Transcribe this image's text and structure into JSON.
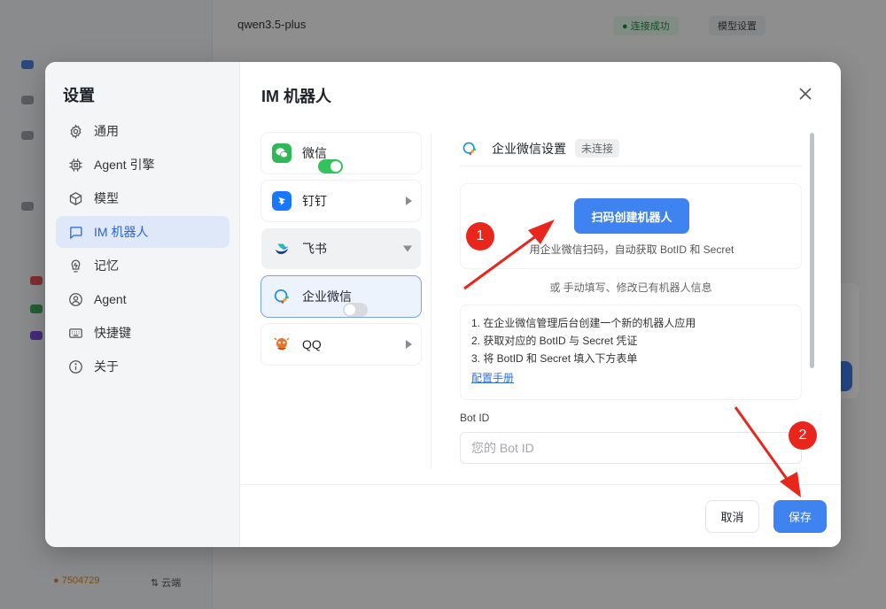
{
  "background": {
    "model_selector": "qwen3.5-plus",
    "status_badge": "● 连接成功",
    "pill": "模型设置",
    "bottom_left": "● 7504729",
    "bottom_right": "⇅ 云端"
  },
  "dialog": {
    "title": "设置",
    "main_title": "IM 机器人",
    "close_icon": "close-icon"
  },
  "nav": [
    {
      "label": "通用",
      "icon": "gear-icon"
    },
    {
      "label": "Agent 引擎",
      "icon": "chip-icon"
    },
    {
      "label": "模型",
      "icon": "cube-icon"
    },
    {
      "label": "IM 机器人",
      "icon": "chat-bubble-icon",
      "active": true
    },
    {
      "label": "记忆",
      "icon": "brain-icon"
    },
    {
      "label": "Agent",
      "icon": "user-circle-icon"
    },
    {
      "label": "快捷键",
      "icon": "keyboard-icon"
    },
    {
      "label": "关于",
      "icon": "info-icon"
    }
  ],
  "channels": [
    {
      "name": "微信",
      "icon": "wechat-icon",
      "control": "toggle",
      "enabled": true
    },
    {
      "name": "钉钉",
      "icon": "dingtalk-icon",
      "control": "arrow-right"
    },
    {
      "name": "飞书",
      "icon": "feishu-icon",
      "control": "arrow-down",
      "expanded": true
    },
    {
      "name": "企业微信",
      "icon": "wecom-icon",
      "control": "toggle",
      "enabled": false,
      "selected": true
    },
    {
      "name": "QQ",
      "icon": "qq-icon",
      "control": "arrow-right"
    }
  ],
  "detail": {
    "header_name": "企业微信设置",
    "status": "未连接",
    "scan_button": "扫码创建机器人",
    "scan_hint": "用企业微信扫码，自动获取 BotID 和 Secret",
    "or_text": "或 手动填写、修改已有机器人信息",
    "steps": [
      "1. 在企业微信管理后台创建一个新的机器人应用",
      "2. 获取对应的 BotID 与 Secret 凭证",
      "3. 将 BotID 和 Secret 填入下方表单"
    ],
    "manual_link": "配置手册",
    "bot_id_label": "Bot ID",
    "bot_id_placeholder": "您的 Bot ID",
    "bot_id_value": ""
  },
  "footer": {
    "cancel": "取消",
    "save": "保存"
  },
  "annotations": {
    "marker_1": "1",
    "marker_2": "2",
    "color": "#e8261c"
  },
  "colors": {
    "primary": "#3f83f0",
    "active_nav_bg": "#dfe8f9",
    "toggle_on": "#34c25c"
  }
}
